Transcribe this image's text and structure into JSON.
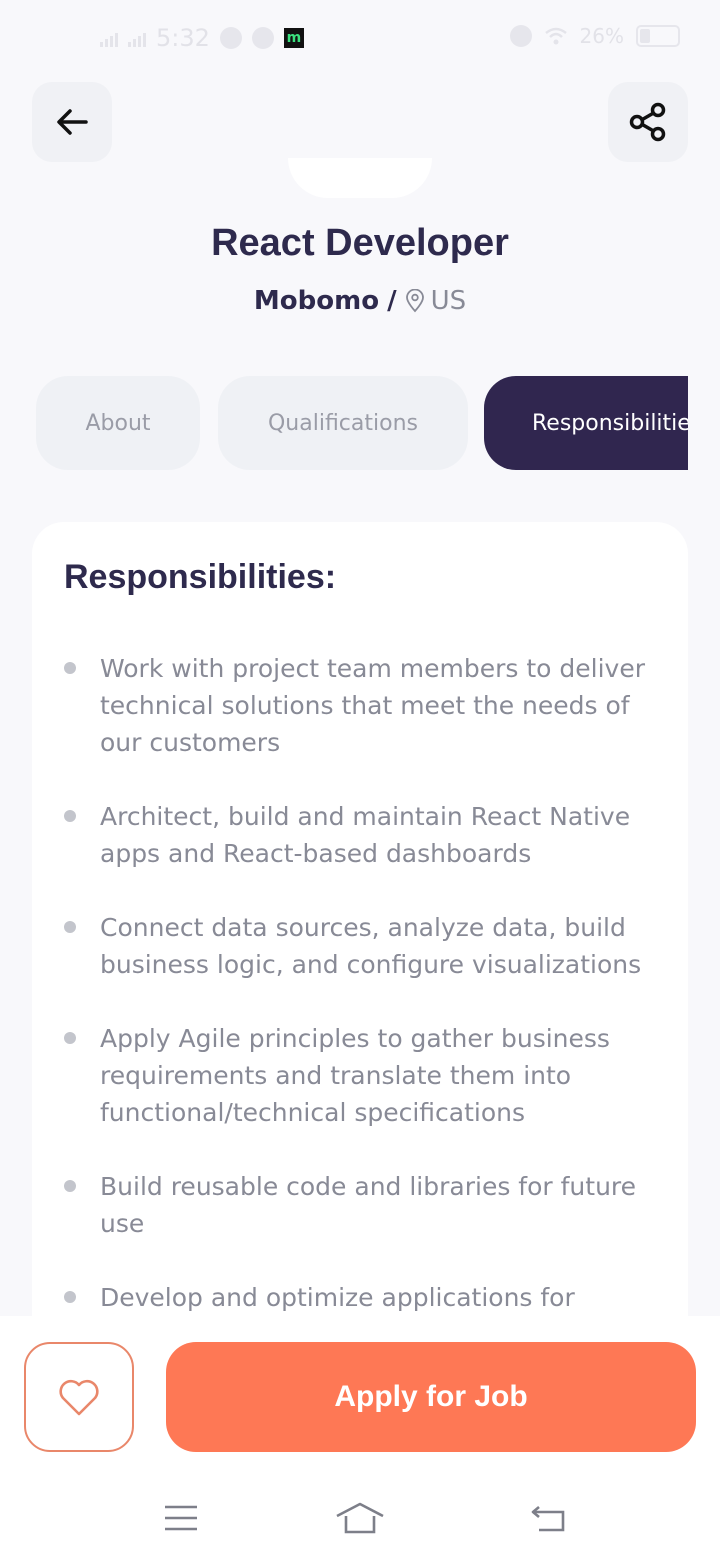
{
  "status_bar": {
    "time": "5:32",
    "battery_percent": "26%"
  },
  "header": {
    "back_icon": "arrow-left-icon",
    "share_icon": "share-icon"
  },
  "job": {
    "title": "React Developer",
    "company": "Mobomo",
    "separator": "/",
    "location": "US"
  },
  "tabs": [
    {
      "label": "About",
      "active": false
    },
    {
      "label": "Qualifications",
      "active": false
    },
    {
      "label": "Responsibilities",
      "active": true
    }
  ],
  "responsibilities": {
    "heading": "Responsibilities:",
    "items": [
      "Work with project team members to deliver technical solutions that meet the needs of our customers",
      "Architect, build and maintain React Native apps and React-based dashboards",
      "Connect data sources, analyze data, build business logic, and configure visualizations",
      "Apply Agile principles to gather business requirements and translate them into functional/technical specifications",
      "Build reusable code and libraries for future use",
      "Develop and optimize applications for"
    ]
  },
  "actions": {
    "favorite_icon": "heart-icon",
    "apply_label": "Apply for Job"
  },
  "colors": {
    "primary_dark": "#30264f",
    "accent": "#fe7855",
    "text_muted": "#888a96"
  }
}
